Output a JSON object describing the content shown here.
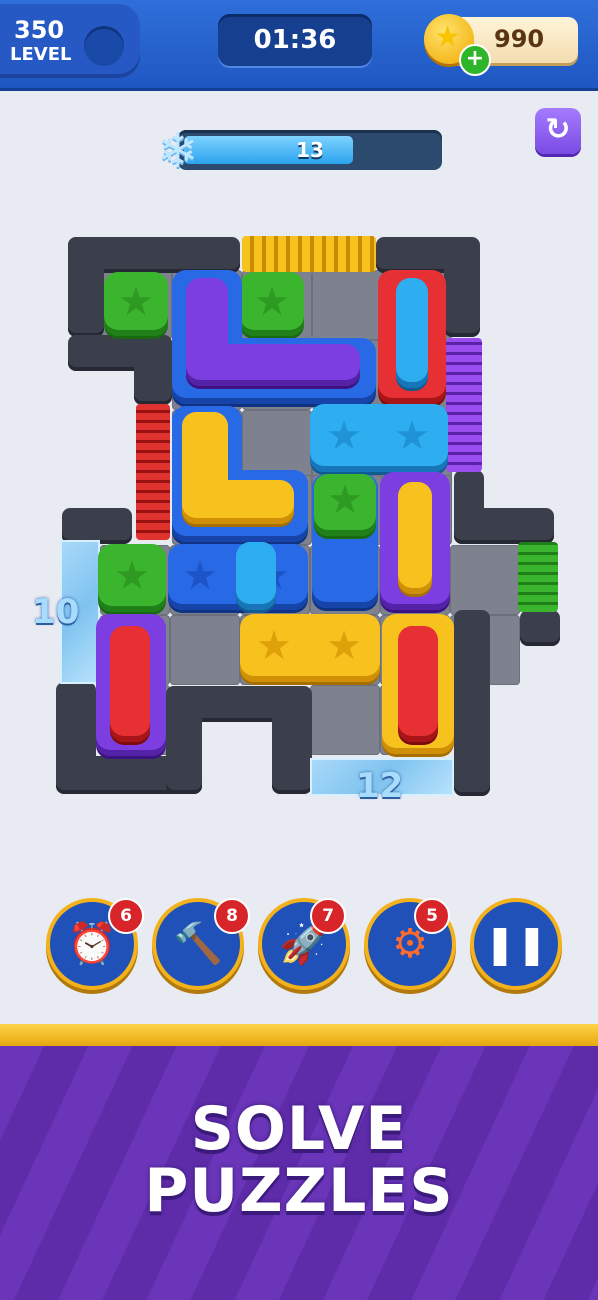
{
  "header": {
    "level_number": "350",
    "level_label": "LEVEL",
    "timer": "01:36",
    "coins": "990",
    "coin_add": "+"
  },
  "freeze_meter": {
    "icon": "snowflake-icon",
    "value": "13",
    "fill_fraction": 0.67
  },
  "restart_icon": "restart-icon",
  "board": {
    "ice_counters": [
      "10",
      "12"
    ],
    "colors": {
      "green": "#3bb52e",
      "blue": "#2869e6",
      "cyan": "#2eaef1",
      "yellow": "#f7c21d",
      "purple": "#7c3ee0",
      "red": "#e63033"
    }
  },
  "boosters": [
    {
      "name": "alarm-clock-icon",
      "count": "6"
    },
    {
      "name": "hammer-icon",
      "count": "8"
    },
    {
      "name": "rocket-icon",
      "count": "7"
    },
    {
      "name": "vacuum-icon",
      "count": "5"
    }
  ],
  "pause_icon": "pause-icon",
  "banner": {
    "line1": "SOLVE",
    "line2": "PUZZLES"
  }
}
